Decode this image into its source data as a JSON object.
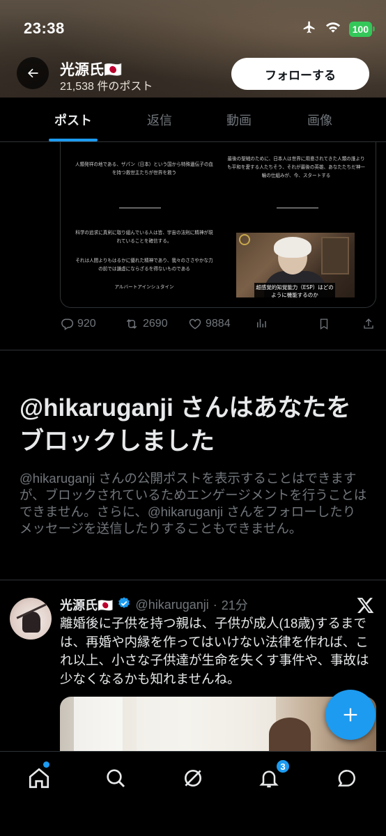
{
  "status_bar": {
    "time": "23:38",
    "battery": "100"
  },
  "header": {
    "name": "光源氏🇯🇵",
    "post_count": "21,538 件のポスト",
    "follow_label": "フォローする"
  },
  "tabs": [
    {
      "label": "ポスト",
      "active": true
    },
    {
      "label": "返信",
      "active": false
    },
    {
      "label": "動画",
      "active": false
    },
    {
      "label": "画像",
      "active": false
    }
  ],
  "media_panels": {
    "top_left": "人類発祥の地である、ザパン（日本）という国から特殊遺伝子の血を持つ救世主たちが世界を救う",
    "top_right": "最後の聖戦のために、日本人は世界に用意されてきた人類の誰よりも平和を愛する人たちそう、それが最後の英雄、あなたたちだ神一輪の仕組みが、今、スタートする",
    "bottom_left_1": "科学の追求に真剣に取り組んでいる人は皆、宇宙の法則に精神が現れていることを確信する。",
    "bottom_left_2": "それは人間よりもはるかに優れた精神であり、我々のささやかな力の前では謙虚にならざるを得ないものである",
    "bottom_left_3": "アルバートアインシュタイン",
    "video_caption": "超感覚的知覚能力（ESP）はどのように機能するのか"
  },
  "actions": {
    "replies": "920",
    "reposts": "2690",
    "likes": "9884"
  },
  "block_notice": {
    "title": "@hikaruganji さんはあなたをブロックしました",
    "description": "@hikaruganji さんの公開ポストを表示することはできますが、ブロックされているためエンゲージメントを行うことはできません。さらに、@hikaruganji さんをフォローしたりメッセージを送信したりすることもできません。"
  },
  "post": {
    "name": "光源氏🇯🇵",
    "handle": "@hikaruganji",
    "time": "21分",
    "text": "離婚後に子供を持つ親は、子供が成人(18歳)するまでは、再婚や内縁を作ってはいけない法律を作れば、これ以上、小さな子供達が生命を失くす事件や、事故は少なくなるかも知れませんね。"
  },
  "notifications_badge": "3",
  "colors": {
    "accent": "#1d9bf0",
    "muted": "#71767b",
    "verified": "#1d9bf0"
  }
}
